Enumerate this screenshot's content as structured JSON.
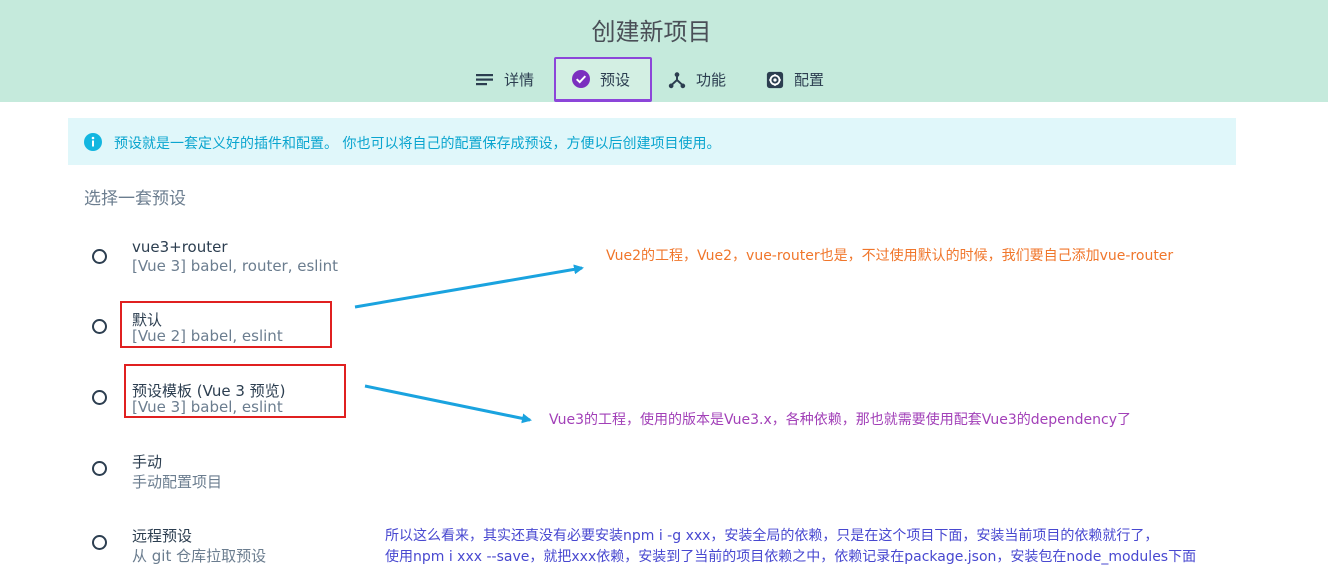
{
  "page": {
    "title": "创建新项目"
  },
  "tabs": [
    {
      "label": "详情",
      "icon": "list-icon"
    },
    {
      "label": "预设",
      "icon": "check-circle-icon",
      "active": true
    },
    {
      "label": "功能",
      "icon": "fork-icon"
    },
    {
      "label": "配置",
      "icon": "settings-icon"
    }
  ],
  "info": {
    "icon": "info-icon",
    "text": "预设就是一套定义好的插件和配置。 你也可以将自己的配置保存成预设，方便以后创建项目使用。"
  },
  "section_title": "选择一套预设",
  "presets": [
    {
      "name": "vue3+router",
      "desc": "[Vue 3] babel, router, eslint",
      "selected": false
    },
    {
      "name": "默认",
      "desc": "[Vue 2] babel, eslint",
      "selected": false
    },
    {
      "name": "预设模板 (Vue 3 预览)",
      "desc": "[Vue 3] babel, eslint",
      "selected": false
    },
    {
      "name": "手动",
      "desc": "手动配置项目",
      "selected": false
    },
    {
      "name": "远程预设",
      "desc": "从 git 仓库拉取预设",
      "selected": false
    }
  ],
  "annotations": {
    "note_vue2": "Vue2的工程，Vue2，vue-router也是，不过使用默认的时候，我们要自己添加vue-router",
    "note_vue3": "Vue3的工程，使用的版本是Vue3.x，各种依赖，那也就需要使用配套Vue3的dependency了",
    "note_npm": [
      "所以这么看来，其实还真没有必要安装npm i -g xxx，安装全局的依赖，只是在这个项目下面，安装当前项目的依赖就行了，",
      "使用npm i xxx --save，就把xxx依赖，安装到了当前的项目依赖之中，依赖记录在package.json，安装包在node_modules下面"
    ]
  },
  "colors": {
    "header_bg": "#c5eadc",
    "active_tab_border": "#8c45d9",
    "info_bg": "#e0f7fa",
    "info_text": "#0aa5cf",
    "annotation_box": "#e02020",
    "arrow": "#1aa3df"
  }
}
